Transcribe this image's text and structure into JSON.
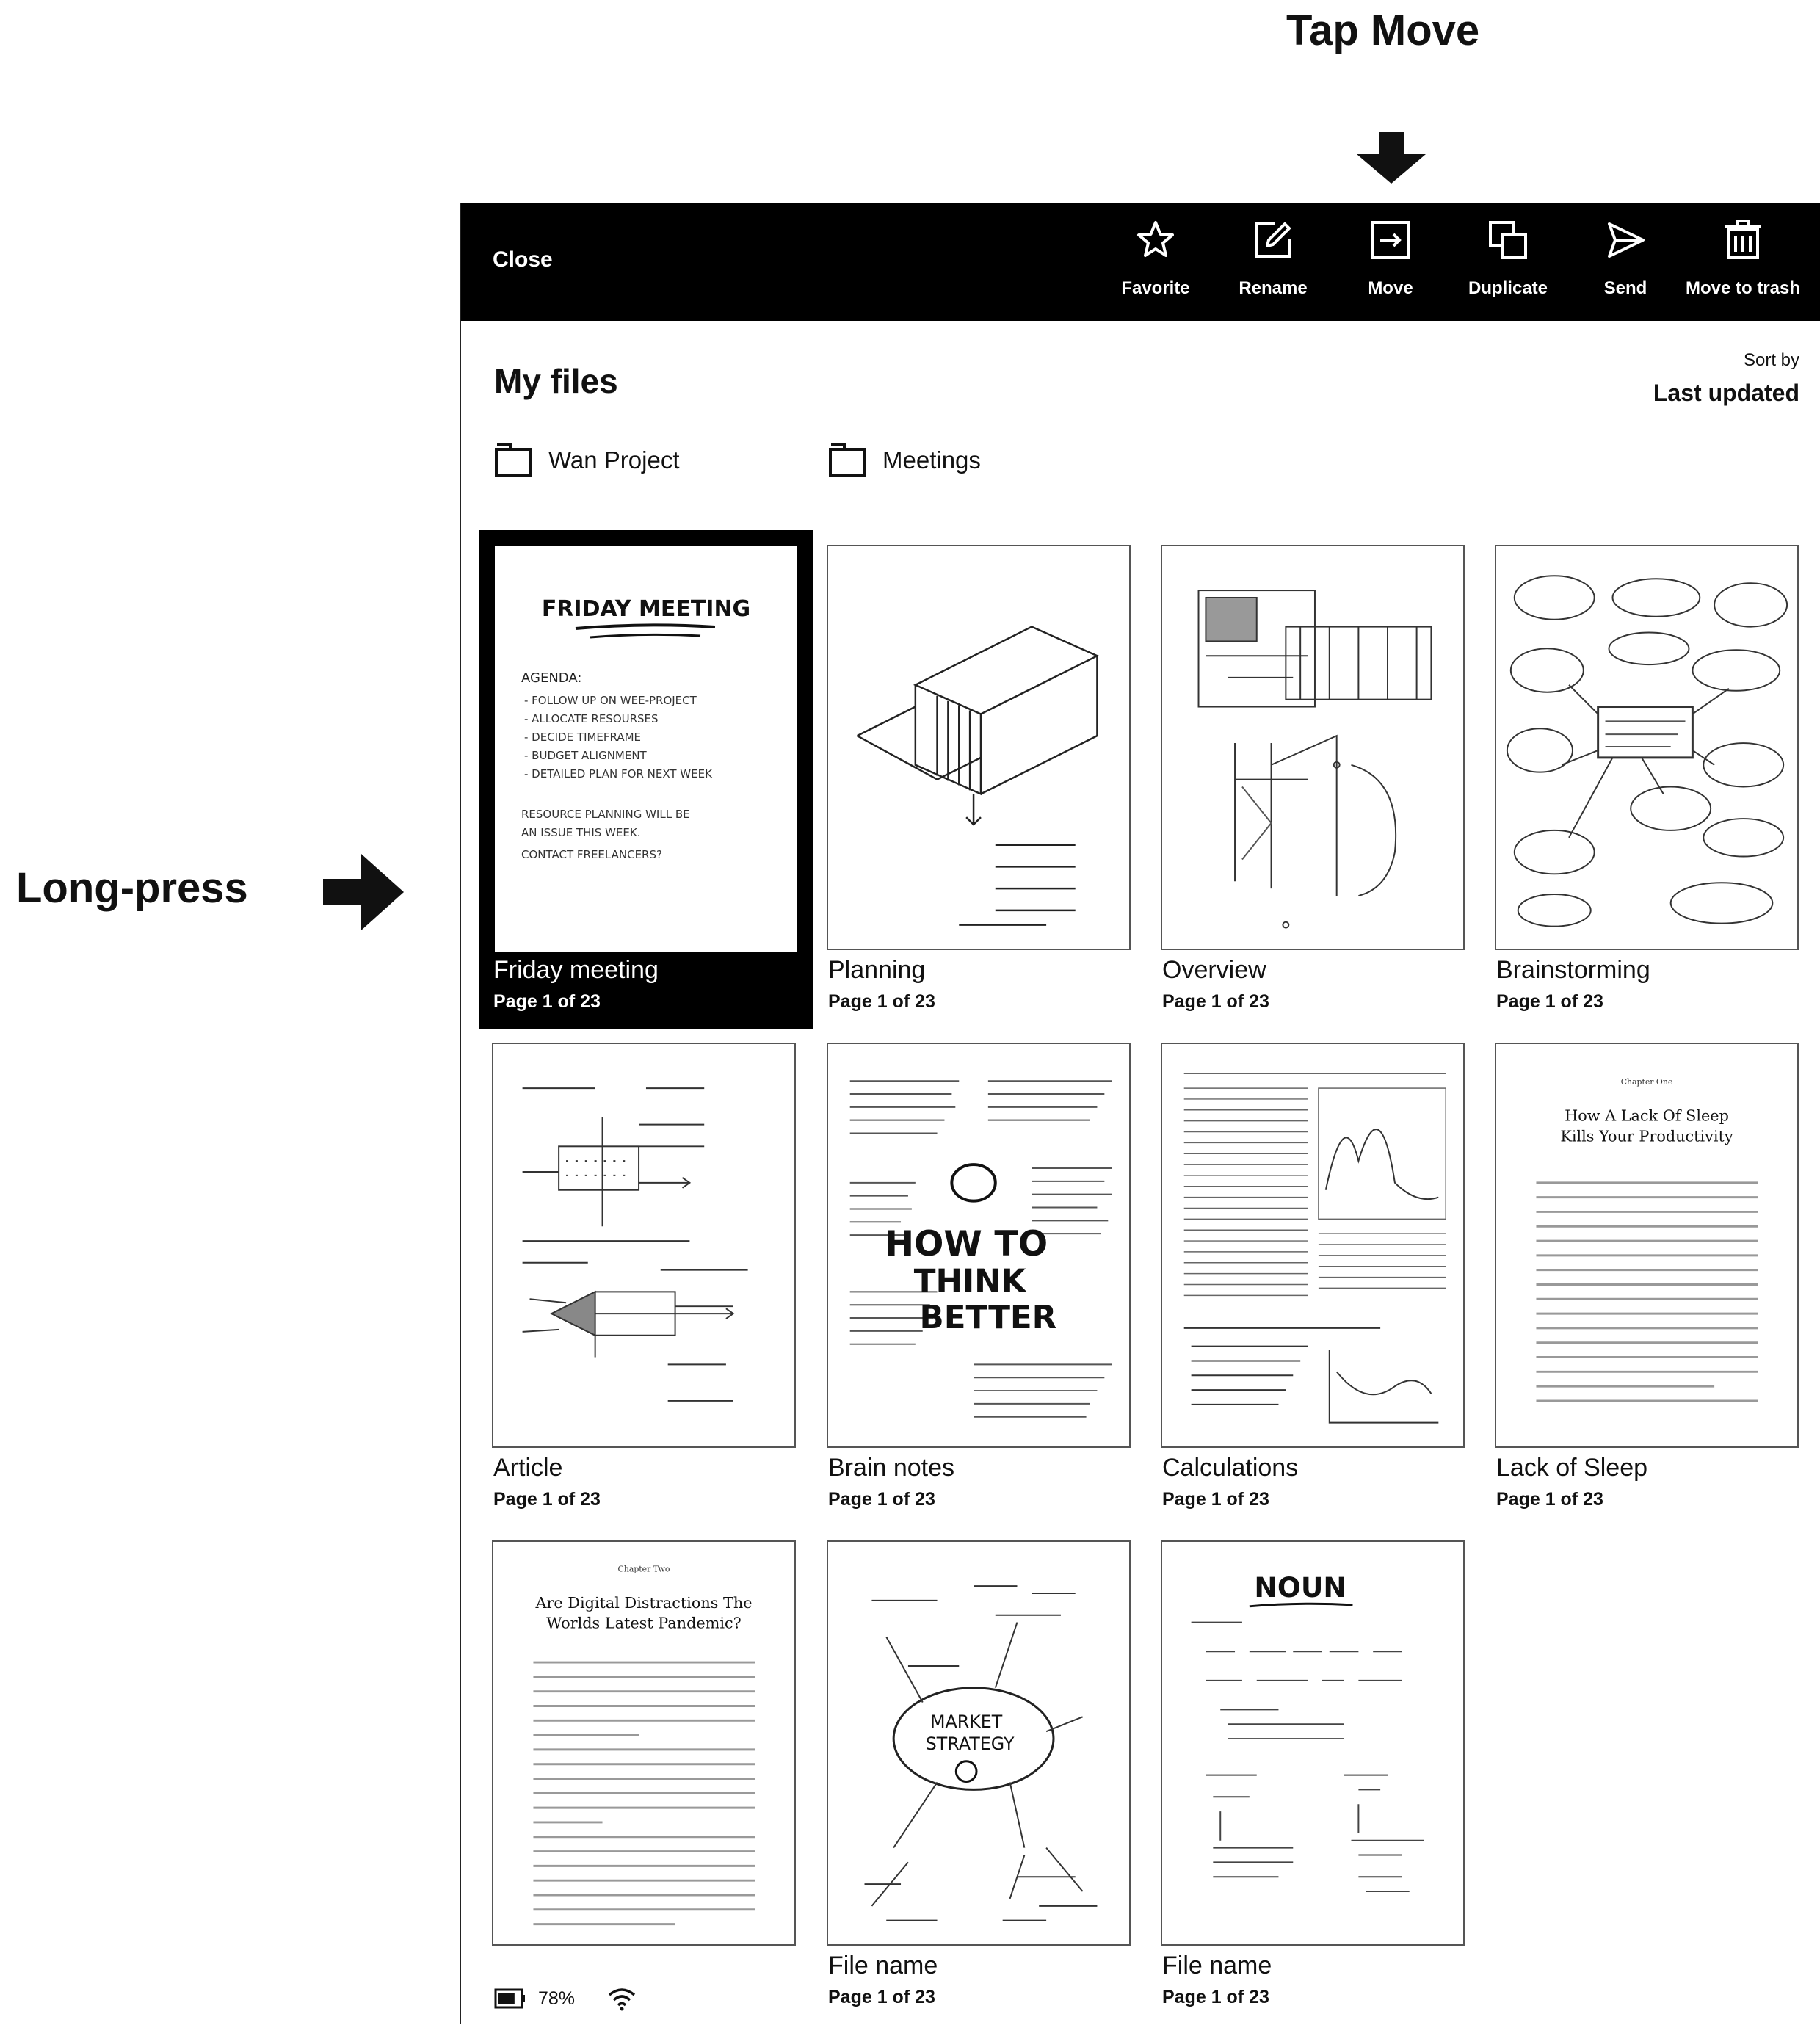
{
  "annotations": {
    "tap_move": "Tap Move",
    "long_press": "Long-press"
  },
  "toolbar": {
    "close_label": "Close",
    "actions": [
      {
        "label": "Favorite",
        "icon": "star-icon"
      },
      {
        "label": "Rename",
        "icon": "pencil-icon"
      },
      {
        "label": "Move",
        "icon": "move-icon"
      },
      {
        "label": "Duplicate",
        "icon": "duplicate-icon"
      },
      {
        "label": "Send",
        "icon": "send-icon"
      },
      {
        "label": "Move to trash",
        "icon": "trash-icon"
      }
    ]
  },
  "header": {
    "title": "My files",
    "sort_by_label": "Sort by",
    "sort_value": "Last updated"
  },
  "folders": [
    {
      "name": "Wan Project",
      "icon": "folder-icon"
    },
    {
      "name": "Meetings",
      "icon": "folder-icon"
    }
  ],
  "files": [
    {
      "name": "Friday meeting",
      "page": "Page 1 of 23",
      "selected": true
    },
    {
      "name": "Planning",
      "page": "Page 1 of 23",
      "selected": false
    },
    {
      "name": "Overview",
      "page": "Page 1 of 23",
      "selected": false
    },
    {
      "name": "Brainstorming",
      "page": "Page 1 of 23",
      "selected": false
    },
    {
      "name": "Article",
      "page": "Page 1 of 23",
      "selected": false
    },
    {
      "name": "Brain notes",
      "page": "Page 1 of 23",
      "selected": false
    },
    {
      "name": "Calculations",
      "page": "Page 1 of 23",
      "selected": false
    },
    {
      "name": "Lack of Sleep",
      "page": "Page 1 of 23",
      "selected": false
    },
    {
      "name": "",
      "page": "",
      "selected": false
    },
    {
      "name": "File name",
      "page": "Page 1 of 23",
      "selected": false
    },
    {
      "name": "File name",
      "page": "Page 1 of 23",
      "selected": false
    }
  ],
  "thumbnails": {
    "friday": {
      "title": "FRIDAY MEETING",
      "agenda": "AGENDA:",
      "items": [
        "- FOLLOW UP ON WEE-PROJECT",
        "- ALLOCATE RESOURSES",
        "- DECIDE TIMEFRAME",
        "- BUDGET ALIGNMENT",
        "- DETAILED PLAN FOR NEXT WEEK"
      ],
      "note": [
        "RESOURCE PLANNING WILL BE",
        "AN ISSUE THIS WEEK.",
        "CONTACT FREELANCERS?"
      ]
    },
    "brain_notes": {
      "big1": "HOW TO",
      "big2": "THINK",
      "big3": "BETTER"
    },
    "sleep": {
      "chapter": "Chapter One",
      "title1": "How A Lack Of Sleep",
      "title2": "Kills Your Productivity"
    },
    "digital": {
      "chapter": "Chapter Two",
      "title1": "Are Digital Distractions The",
      "title2": "Worlds Latest Pandemic?"
    },
    "noun": {
      "title": "NOUN"
    },
    "market": {
      "title1": "MARKET",
      "title2": "STRATEGY"
    }
  },
  "status": {
    "battery": "78%",
    "battery_level": 0.78,
    "icons": [
      "battery-icon",
      "wifi-icon"
    ]
  }
}
